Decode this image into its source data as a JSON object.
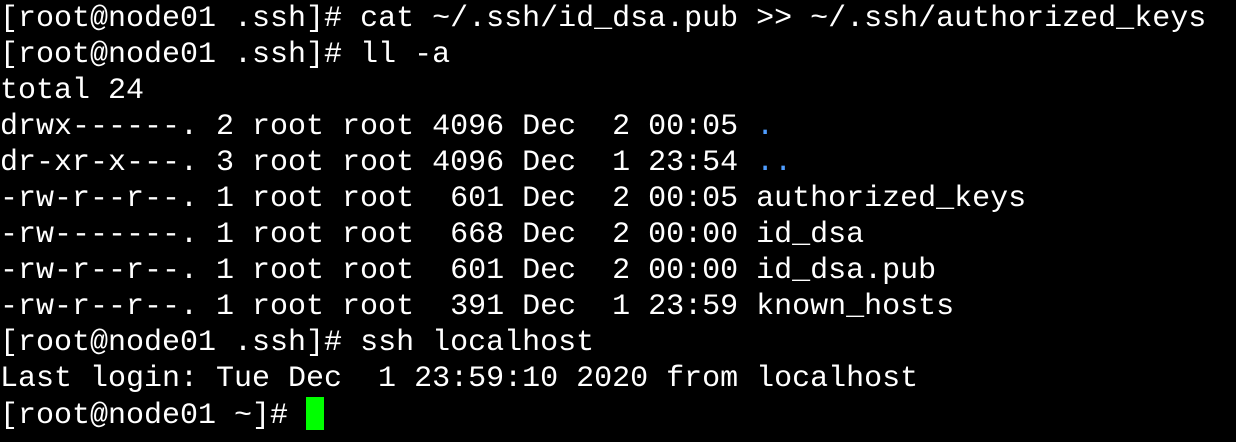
{
  "colors": {
    "background": "#000000",
    "foreground": "#ffffff",
    "directory": "#4f9dff",
    "cursor": "#00ff00"
  },
  "terminal": {
    "commands": [
      {
        "prompt": "[root@node01 .ssh]# ",
        "text": "cat ~/.ssh/id_dsa.pub >> ~/.ssh/authorized_keys"
      },
      {
        "prompt": "[root@node01 .ssh]# ",
        "text": "ll -a"
      }
    ],
    "total": "total 24",
    "listing": [
      {
        "meta": "drwx------. 2 root root 4096 Dec  2 00:05 ",
        "name": ".",
        "is_dir": true
      },
      {
        "meta": "dr-xr-x---. 3 root root 4096 Dec  1 23:54 ",
        "name": "..",
        "is_dir": true
      },
      {
        "meta": "-rw-r--r--. 1 root root  601 Dec  2 00:05 ",
        "name": "authorized_keys",
        "is_dir": false
      },
      {
        "meta": "-rw-------. 1 root root  668 Dec  2 00:00 ",
        "name": "id_dsa",
        "is_dir": false
      },
      {
        "meta": "-rw-r--r--. 1 root root  601 Dec  2 00:00 ",
        "name": "id_dsa.pub",
        "is_dir": false
      },
      {
        "meta": "-rw-r--r--. 1 root root  391 Dec  1 23:59 ",
        "name": "known_hosts",
        "is_dir": false
      }
    ],
    "ssh_command": {
      "prompt": "[root@node01 .ssh]# ",
      "text": "ssh localhost"
    },
    "last_login": "Last login: Tue Dec  1 23:59:10 2020 from localhost",
    "final_prompt": "[root@node01 ~]# "
  }
}
